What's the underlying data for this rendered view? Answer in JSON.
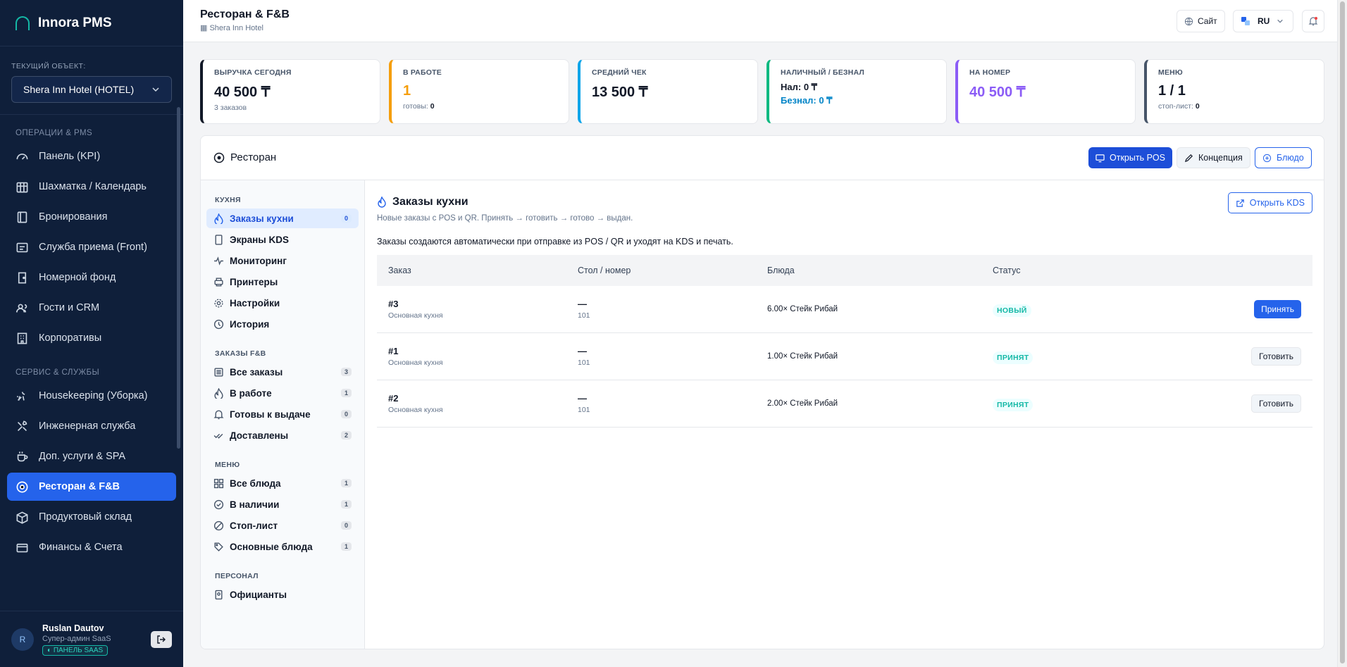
{
  "sidebar": {
    "brand": "Innora PMS",
    "object_label": "ТЕКУЩИЙ ОБЪЕКТ:",
    "object_value": "Shera Inn Hotel (HOTEL)",
    "sections": [
      {
        "title": "ОПЕРАЦИИ & PMS",
        "items": [
          "Панель (KPI)",
          "Шахматка / Календарь",
          "Бронирования",
          "Служба приема (Front)",
          "Номерной фонд",
          "Гости и CRM",
          "Корпоративы"
        ]
      },
      {
        "title": "СЕРВИС & СЛУЖБЫ",
        "items": [
          "Housekeeping (Уборка)",
          "Инженерная служба",
          "Доп. услуги & SPA",
          "Ресторан & F&B",
          "Продуктовый склад",
          "Финансы & Счета"
        ]
      }
    ],
    "active_item": "Ресторан & F&B",
    "user": {
      "name": "Ruslan Dautov",
      "role": "Супер-админ SaaS",
      "badge": "ПАНЕЛЬ SAAS",
      "initial": "R"
    }
  },
  "header": {
    "title": "Ресторан & F&B",
    "subtitle": "Shera Inn Hotel",
    "site_btn": "Сайт",
    "lang": "RU"
  },
  "kpis": [
    {
      "label": "ВЫРУЧКА СЕГОДНЯ",
      "value": "40 500 ₸",
      "sub_text": "3 заказов",
      "sub_value": "",
      "color": "#111827",
      "border": "#111827"
    },
    {
      "label": "В РАБОТЕ",
      "value": "1",
      "sub_text": "готовы:",
      "sub_value": "0",
      "color": "#f59e0b",
      "border": "#f59e0b"
    },
    {
      "label": "СРЕДНИЙ ЧЕК",
      "value": "13 500 ₸",
      "sub_text": "",
      "sub_value": "",
      "color": "#111827",
      "border": "#0ea5e9"
    },
    {
      "label": "НАЛИЧНЫЙ / БЕЗНАЛ",
      "value": "",
      "line1": "Нал: 0 ₸",
      "line2": "Безнал: 0 ₸",
      "sub_text": "",
      "sub_value": "",
      "color": "#111827",
      "border": "#10b981"
    },
    {
      "label": "НА НОМЕР",
      "value": "40 500 ₸",
      "sub_text": "",
      "sub_value": "",
      "color": "#8b5cf6",
      "border": "#8b5cf6"
    },
    {
      "label": "МЕНЮ",
      "value": "1 / 1",
      "sub_text": "стоп-лист:",
      "sub_value": "0",
      "color": "#111827",
      "border": "#475569"
    }
  ],
  "panel": {
    "title": "Ресторан",
    "buttons": {
      "pos": "Открыть POS",
      "concept": "Концепция",
      "dish": "Блюдо"
    },
    "subnav": [
      {
        "title": "КУХНЯ",
        "items": [
          {
            "label": "Заказы кухни",
            "count": "0",
            "icon": "flame-icon",
            "active": true
          },
          {
            "label": "Экраны KDS",
            "count": "",
            "icon": "tablet-icon"
          },
          {
            "label": "Мониторинг",
            "count": "",
            "icon": "activity-icon"
          },
          {
            "label": "Принтеры",
            "count": "",
            "icon": "printer-icon"
          },
          {
            "label": "Настройки",
            "count": "",
            "icon": "gear-icon"
          },
          {
            "label": "История",
            "count": "",
            "icon": "clock-icon"
          }
        ]
      },
      {
        "title": "ЗАКАЗЫ F&B",
        "items": [
          {
            "label": "Все заказы",
            "count": "3",
            "icon": "list-icon"
          },
          {
            "label": "В работе",
            "count": "1",
            "icon": "flame-icon"
          },
          {
            "label": "Готовы к выдаче",
            "count": "0",
            "icon": "bell-icon"
          },
          {
            "label": "Доставлены",
            "count": "2",
            "icon": "double-check-icon"
          }
        ]
      },
      {
        "title": "МЕНЮ",
        "items": [
          {
            "label": "Все блюда",
            "count": "1",
            "icon": "grid-icon"
          },
          {
            "label": "В наличии",
            "count": "1",
            "icon": "check-circle-icon"
          },
          {
            "label": "Стоп-лист",
            "count": "0",
            "icon": "ban-icon"
          },
          {
            "label": "Основные блюда",
            "count": "1",
            "icon": "tag-icon"
          }
        ]
      },
      {
        "title": "ПЕРСОНАЛ",
        "items": [
          {
            "label": "Официанты",
            "count": "",
            "icon": "badge-icon"
          }
        ]
      }
    ]
  },
  "content": {
    "title": "Заказы кухни",
    "desc": "Новые заказы с POS и QR. Принять → готовить → готово → выдан.",
    "note": "Заказы создаются автоматически при отправке из POS / QR и уходят на KDS и печать.",
    "kds_button": "Открыть KDS",
    "columns": [
      "Заказ",
      "Стол / номер",
      "Блюда",
      "Статус"
    ],
    "orders": [
      {
        "id": "#3",
        "kitchen": "Основная кухня",
        "table": "—",
        "room": "101",
        "dishes": "6.00× Стейк Рибай",
        "status": "НОВЫЙ",
        "action": "Принять",
        "primary": true
      },
      {
        "id": "#1",
        "kitchen": "Основная кухня",
        "table": "—",
        "room": "101",
        "dishes": "1.00× Стейк Рибай",
        "status": "ПРИНЯТ",
        "action": "Готовить",
        "primary": false
      },
      {
        "id": "#2",
        "kitchen": "Основная кухня",
        "table": "—",
        "room": "101",
        "dishes": "2.00× Стейк Рибай",
        "status": "ПРИНЯТ",
        "action": "Готовить",
        "primary": false
      }
    ]
  }
}
